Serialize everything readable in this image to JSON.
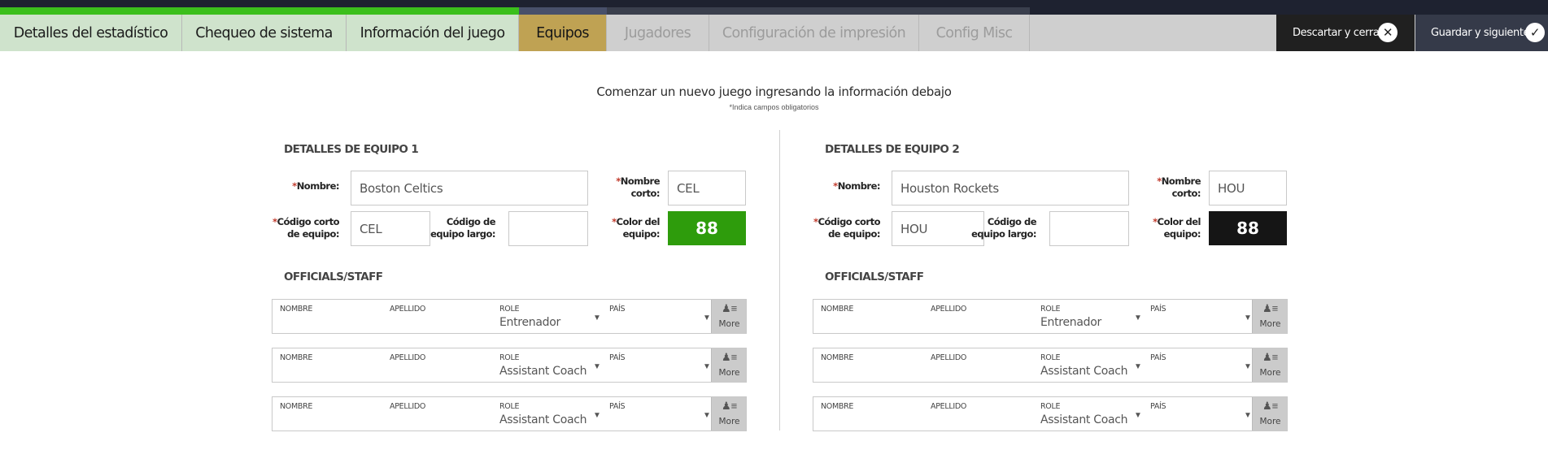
{
  "tabs": [
    {
      "label": "Detalles del estadístico",
      "state": "done"
    },
    {
      "label": "Chequeo de sistema",
      "state": "done"
    },
    {
      "label": "Información del juego",
      "state": "done"
    },
    {
      "label": "Equipos",
      "state": "active"
    },
    {
      "label": "Jugadores",
      "state": "todo"
    },
    {
      "label": "Configuración de impresión",
      "state": "todo"
    },
    {
      "label": "Config Misc",
      "state": "todo"
    }
  ],
  "actions": {
    "discard_label": "Descartar y cerrar",
    "discard_icon": "close-icon",
    "save_label": "Guardar y siguiente",
    "save_icon": "check-icon"
  },
  "intro": {
    "title": "Comenzar un nuevo juego ingresando la información debajo",
    "required_note": "*Indica campos obligatorios"
  },
  "labels": {
    "required_mark": "*",
    "name": "Nombre:",
    "short_name": "Nombre corto:",
    "short_code_1": "Código corto",
    "short_code_2": "de equipo:",
    "long_code_1": "Código de",
    "long_code_2": "equipo largo:",
    "color_1": "Color del",
    "color_2": "equipo:",
    "staff_title": "OFFICIALS/STAFF",
    "col_first": "NOMBRE",
    "col_last": "APELLIDO",
    "col_role": "ROLE",
    "col_country": "PAÍS",
    "more": "More"
  },
  "team1": {
    "title": "DETALLES DE EQUIPO 1",
    "name": "Boston Celtics",
    "short_name": "CEL",
    "short_code": "CEL",
    "long_code": "",
    "color_label": "88",
    "color": "#2e9c0c",
    "staff": [
      {
        "first": "",
        "last": "",
        "role": "Entrenador",
        "country": ""
      },
      {
        "first": "",
        "last": "",
        "role": "Assistant Coach",
        "country": ""
      },
      {
        "first": "",
        "last": "",
        "role": "Assistant Coach",
        "country": ""
      }
    ]
  },
  "team2": {
    "title": "DETALLES DE EQUIPO 2",
    "name": "Houston Rockets",
    "short_name": "HOU",
    "short_code": "HOU",
    "long_code": "",
    "color_label": "88",
    "color": "#151515",
    "staff": [
      {
        "first": "",
        "last": "",
        "role": "Entrenador",
        "country": ""
      },
      {
        "first": "",
        "last": "",
        "role": "Assistant Coach",
        "country": ""
      },
      {
        "first": "",
        "last": "",
        "role": "Assistant Coach",
        "country": ""
      }
    ]
  },
  "colors": {
    "progress_done": "#3bbf1c",
    "tab_done_bg": "#cfe3cc",
    "tab_active_bg": "#bfa253",
    "tab_todo_bg": "#cfcfcf",
    "required": "#c0392b"
  }
}
